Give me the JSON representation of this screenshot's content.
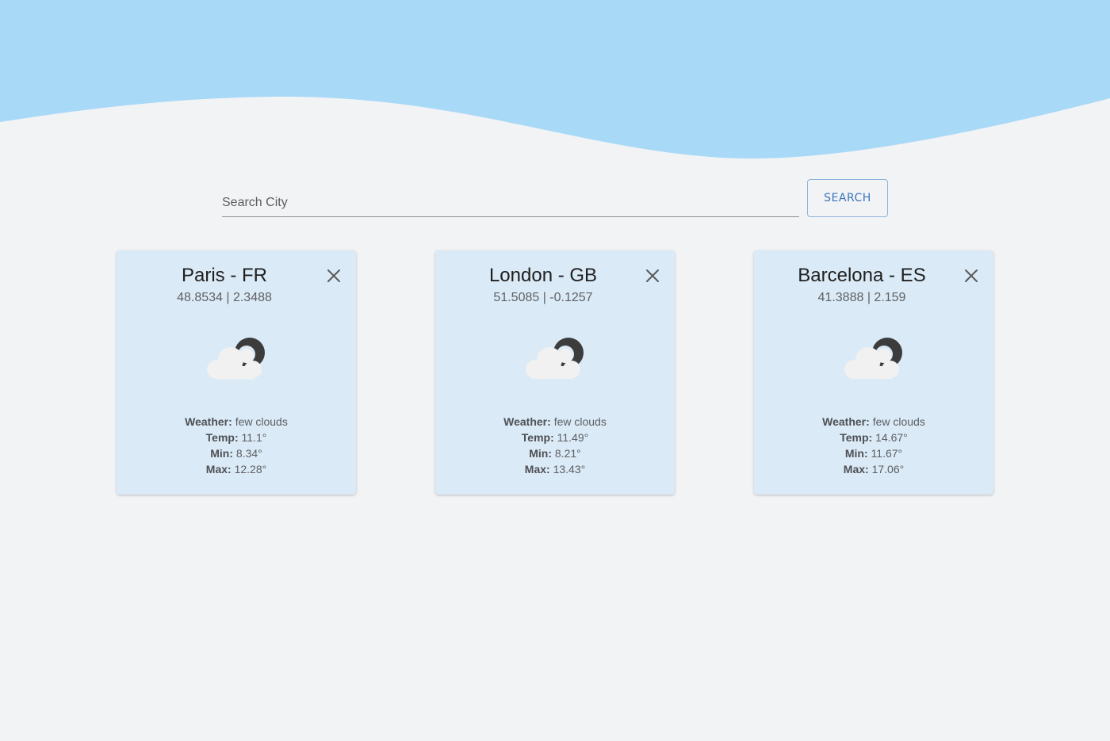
{
  "colors": {
    "page_background": "#f2f3f5",
    "wave": "#a8d9f7",
    "card_background": "#daeaf6",
    "accent": "#3a73bd"
  },
  "search": {
    "placeholder": "Search City",
    "value": "",
    "button_label": "SEARCH"
  },
  "labels": {
    "weather": "Weather:",
    "temp": "Temp:",
    "min": "Min:",
    "max": "Max:"
  },
  "cards": [
    {
      "title": "Paris - FR",
      "coords": "48.8534 | 2.3488",
      "icon": "few-clouds-night-icon",
      "weather": "few clouds",
      "temp": "11.1°",
      "min": "8.34°",
      "max": "12.28°"
    },
    {
      "title": "London - GB",
      "coords": "51.5085 | -0.1257",
      "icon": "few-clouds-night-icon",
      "weather": "few clouds",
      "temp": "11.49°",
      "min": "8.21°",
      "max": "13.43°"
    },
    {
      "title": "Barcelona - ES",
      "coords": "41.3888 | 2.159",
      "icon": "few-clouds-night-icon",
      "weather": "few clouds",
      "temp": "14.67°",
      "min": "11.67°",
      "max": "17.06°"
    }
  ]
}
